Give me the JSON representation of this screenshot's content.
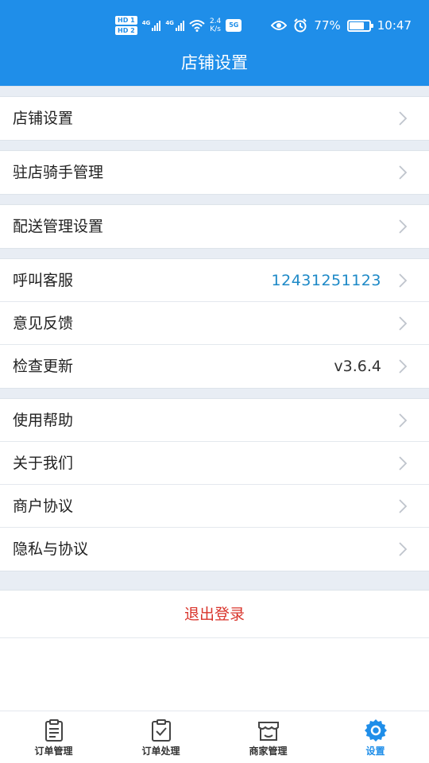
{
  "status_bar": {
    "hd1": "HD 1",
    "hd2": "HD 2",
    "net1": "4G",
    "net2": "4G",
    "speed_value": "2.4",
    "speed_unit": "K/s",
    "app_badge": "5G",
    "battery": "77%",
    "battery_level": 0.77,
    "time": "10:47"
  },
  "header": {
    "title": "店铺设置"
  },
  "groups": [
    [
      {
        "label": "店铺设置",
        "value": ""
      }
    ],
    [
      {
        "label": "驻店骑手管理",
        "value": ""
      }
    ],
    [
      {
        "label": "配送管理设置",
        "value": ""
      }
    ],
    [
      {
        "label": "呼叫客服",
        "value": "12431251123"
      },
      {
        "label": "意见反馈",
        "value": ""
      },
      {
        "label": "检查更新",
        "value": "v3.6.4"
      }
    ],
    [
      {
        "label": "使用帮助",
        "value": ""
      },
      {
        "label": "关于我们",
        "value": ""
      },
      {
        "label": "商户协议",
        "value": ""
      },
      {
        "label": "隐私与协议",
        "value": ""
      }
    ]
  ],
  "logout_label": "退出登录",
  "tabbar": {
    "tabs": [
      {
        "label": "订单管理",
        "icon": "clipboard-icon"
      },
      {
        "label": "订单处理",
        "icon": "clipboard-check-icon"
      },
      {
        "label": "商家管理",
        "icon": "store-icon"
      },
      {
        "label": "设置",
        "icon": "gear-icon"
      }
    ],
    "active_index": 3
  },
  "colors": {
    "brand": "#1f8ee9",
    "phone": "#1d89c7",
    "logout": "#d9342b",
    "separator": "#e8edf4"
  }
}
